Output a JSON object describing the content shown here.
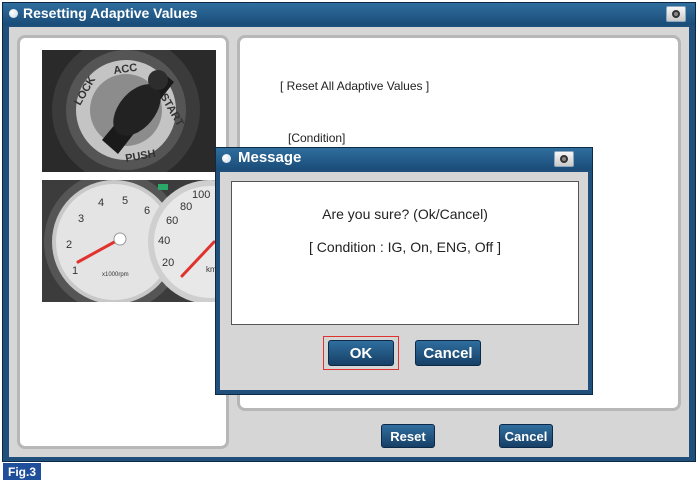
{
  "window": {
    "title": "Resetting Adaptive Values",
    "screenshot_icon": "camera-icon"
  },
  "right_panel": {
    "heading": "[ Reset All Adaptive Values ]",
    "condition_label": "[Condition]"
  },
  "buttons": {
    "reset": "Reset",
    "cancel": "Cancel"
  },
  "dialog": {
    "title": "Message",
    "line1": "Are you sure? (Ok/Cancel)",
    "line2": "[ Condition : IG, On, ENG, Off ]",
    "ok": "OK",
    "cancel": "Cancel",
    "screenshot_icon": "camera-icon"
  },
  "ignition_image": {
    "labels": [
      "LOCK",
      "ACC",
      "START",
      "PUSH"
    ]
  },
  "gauge_image": {
    "tach_ticks": [
      "1",
      "2",
      "3",
      "4",
      "5",
      "6"
    ],
    "tach_unit": "x1000rpm",
    "speed_ticks": [
      "20",
      "40",
      "60",
      "80",
      "100"
    ],
    "speed_unit": "km/h"
  },
  "figure_label": "Fig.3",
  "colors": {
    "titlebar": "#1f4f7a",
    "button": "#1f4f7a",
    "highlight": "#e0322e",
    "panel_bg": "#d6d6d6"
  }
}
